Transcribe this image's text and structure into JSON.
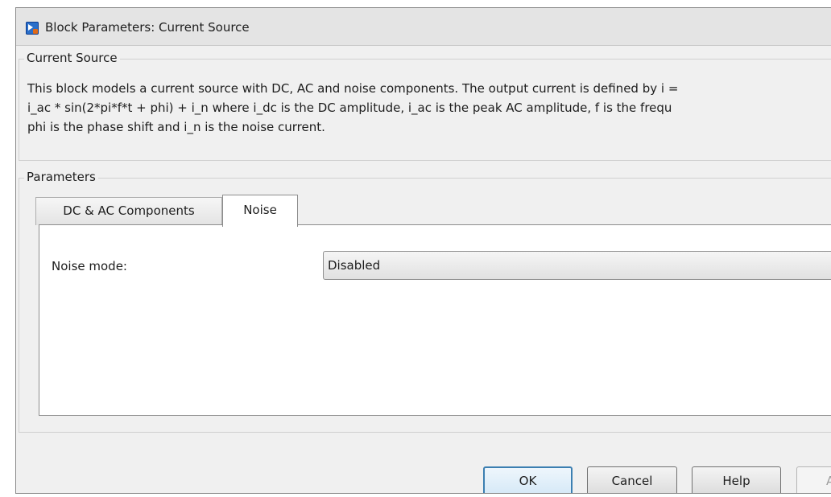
{
  "window": {
    "title": "Block Parameters: Current Source"
  },
  "description": {
    "group_label": "Current Source",
    "text": "This block models a current source with DC, AC and noise components. The output current is defined by i = i_ac * sin(2*pi*f*t + phi) + i_n where i_dc is the DC amplitude, i_ac is the peak AC amplitude, f is the frequ phi is the phase shift and i_n is the noise current.",
    "lines": [
      "This block models a current source with DC, AC and noise components. The output current is defined by i =",
      "i_ac * sin(2*pi*f*t + phi) + i_n where i_dc is the DC amplitude, i_ac is the peak AC amplitude, f is the frequ",
      "phi is the phase shift and i_n is the noise current."
    ]
  },
  "parameters": {
    "group_label": "Parameters",
    "tabs": [
      {
        "label": "DC & AC Components",
        "active": false
      },
      {
        "label": "Noise",
        "active": true
      }
    ],
    "noise_mode": {
      "label": "Noise mode:",
      "value": "Disabled"
    }
  },
  "buttons": {
    "ok": "OK",
    "cancel": "Cancel",
    "help": "Help",
    "apply": "A"
  }
}
